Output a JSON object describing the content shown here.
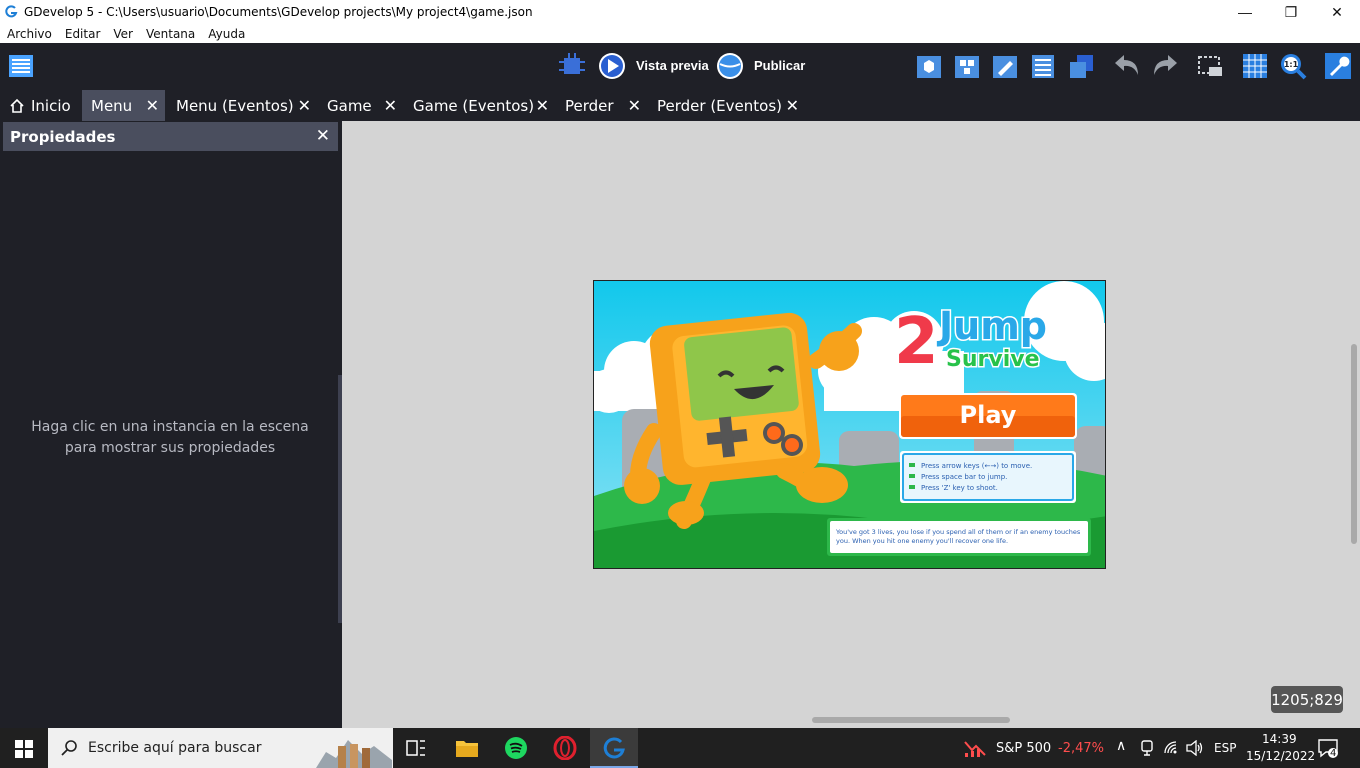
{
  "window": {
    "title": "GDevelop 5 - C:\\Users\\usuario\\Documents\\GDevelop projects\\My project4\\game.json",
    "minimize": "—",
    "maximize": "❐",
    "close": "✕"
  },
  "menubar": [
    "Archivo",
    "Editar",
    "Ver",
    "Ventana",
    "Ayuda"
  ],
  "toolbar": {
    "preview_label": "Vista previa",
    "publish_label": "Publicar"
  },
  "tabs": [
    {
      "label": "Inicio",
      "closable": false,
      "active": false
    },
    {
      "label": "Menu",
      "closable": true,
      "active": true
    },
    {
      "label": "Menu (Eventos)",
      "closable": true,
      "active": false
    },
    {
      "label": "Game",
      "closable": true,
      "active": false
    },
    {
      "label": "Game (Eventos)",
      "closable": true,
      "active": false
    },
    {
      "label": "Perder",
      "closable": true,
      "active": false
    },
    {
      "label": "Perder (Eventos)",
      "closable": true,
      "active": false
    }
  ],
  "properties": {
    "title": "Propiedades",
    "hint": "Haga clic en una instancia en la escena para mostrar sus propiedades"
  },
  "game": {
    "title_number": "2",
    "title_line1": "Jump",
    "title_line2": "Survive",
    "play_button": "Play",
    "instructions": [
      "Press arrow keys (←→) to move.",
      "Press space bar to jump.",
      "Press 'Z' key to shoot."
    ],
    "lives_note": "You've got 3 lives, you lose if you spend all of them or if an enemy touches you. When you hit one enemy you'll recover one life."
  },
  "canvas": {
    "coordinates": "1205;829"
  },
  "taskbar": {
    "search_placeholder": "Escribe aquí para buscar",
    "stock_name": "S&P 500",
    "stock_change": "-2,47%",
    "language": "ESP",
    "time": "14:39",
    "date": "15/12/2022",
    "notifications": "4"
  },
  "colors": {
    "toolbar_bg": "#1f2027",
    "tab_active_bg": "#4a4e5e",
    "canvas_bg": "#d4d4d4",
    "stock_negative": "#ff4d4d"
  }
}
